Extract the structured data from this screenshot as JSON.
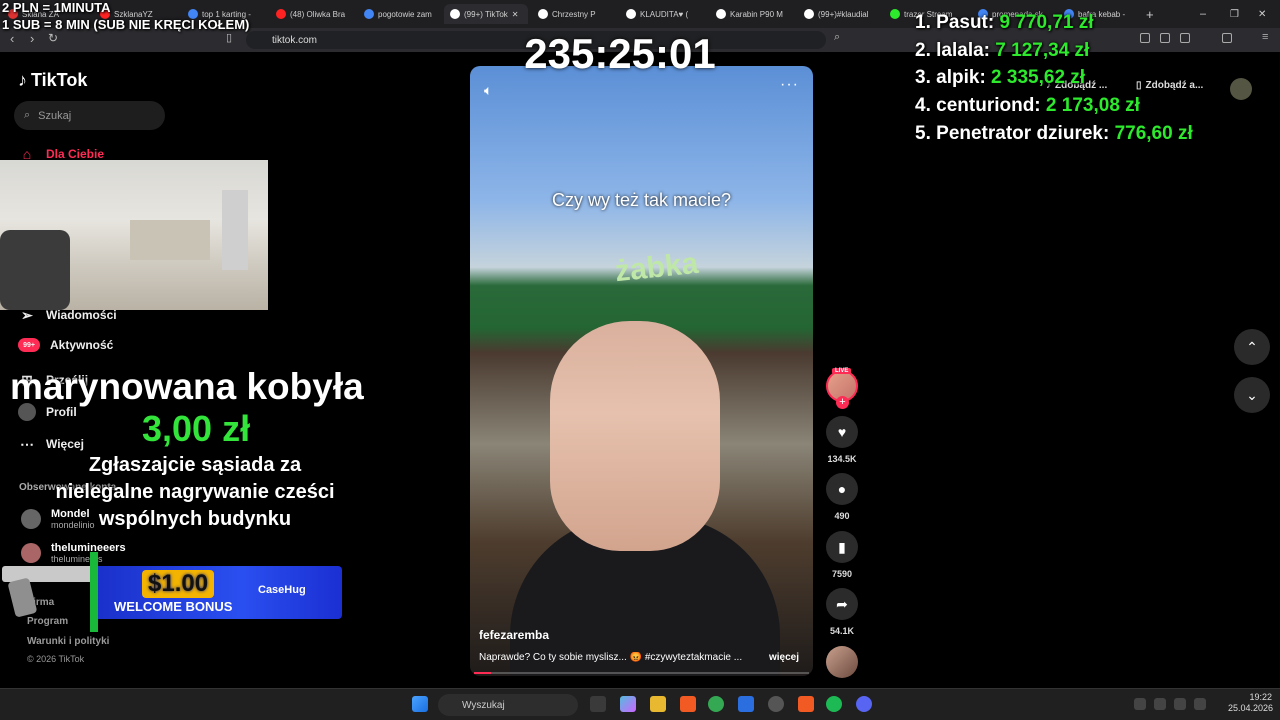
{
  "browser": {
    "tabs": [
      {
        "label": "Sklana ZA",
        "color": "#d33"
      },
      {
        "label": "SzklanaYZ",
        "color": "#f22"
      },
      {
        "label": "top 1 karting -",
        "color": "#4285f4"
      },
      {
        "label": "(48) Oliwka Bra",
        "color": "#f22"
      },
      {
        "label": "pogotowie zam",
        "color": "#4285f4"
      },
      {
        "label": "(99+) TikTok",
        "color": "#fff"
      },
      {
        "label": "Chrzestny P",
        "color": "#fff"
      },
      {
        "label": "KLAUDITA♥ (",
        "color": "#fff"
      },
      {
        "label": "Karabin P90 M",
        "color": "#fff"
      },
      {
        "label": "(99+)#klaudial",
        "color": "#fff"
      },
      {
        "label": "trazer Stream",
        "color": "#2dea2d"
      },
      {
        "label": "promenada sk",
        "color": "#4285f4"
      },
      {
        "label": "bafra kebab -",
        "color": "#4285f4"
      }
    ],
    "url": "tiktok.com"
  },
  "overlay": {
    "rule_line1": "2 PLN = 1MINUTA",
    "rule_line2": "1 SUB = 8 MIN (SUB NIE KRĘCI KOŁEM)",
    "timer": "235:25:01",
    "leaderboard": [
      {
        "rank": "1.",
        "name": "Pasut:",
        "amount": "9 770,71 zł"
      },
      {
        "rank": "2.",
        "name": "lalala:",
        "amount": "7 127,34 zł"
      },
      {
        "rank": "3.",
        "name": "alpik:",
        "amount": "2 335,62 zł"
      },
      {
        "rank": "4.",
        "name": "centuriond:",
        "amount": "2 173,08 zł"
      },
      {
        "rank": "5.",
        "name": "Penetrator dziurek:",
        "amount": "776,60 zł"
      }
    ],
    "donation": {
      "name": "marynowana kobyła",
      "amount": "3,00 zł",
      "message": "Zgłaszajcie sąsiada za nielegalne nagrywanie cześci wspólnych budynku"
    },
    "casehug": {
      "amount": "$1.00",
      "bonus": "WELCOME BONUS",
      "brand": "CaseHug"
    }
  },
  "tiktok": {
    "logo": "TikTok",
    "search_placeholder": "Szukaj",
    "nav": {
      "for_you": "Dla Ciebie",
      "messages": "Wiadomości",
      "activity": "Aktywność",
      "activity_badge": "99+",
      "upload": "Prześlij",
      "profile": "Profil",
      "more": "Więcej"
    },
    "following_header": "Obserwowane konta",
    "following": [
      {
        "name": "Mondel",
        "handle": "mondelinio"
      },
      {
        "name": "thelumineeers",
        "handle": "thelumineers"
      }
    ],
    "footer": [
      "Firma",
      "Program",
      "Warunki i polityki",
      "© 2026 TikTok"
    ],
    "promo": [
      "Zdobądź ...",
      "Zdobądź a..."
    ],
    "video": {
      "caption": "Czy wy też tak macie?",
      "store_sign": "żabka",
      "author": "fefezaremba",
      "description": "Naprawde? Co ty sobie myslisz... 😡 #czywyteztakmacie ...",
      "more": "więcej",
      "live": "LIVE",
      "likes": "134.5K",
      "comments": "490",
      "saves": "7590",
      "shares": "54.1K"
    }
  },
  "taskbar": {
    "search": "Wyszukaj",
    "time": "19:22",
    "date": "25.04.2026"
  }
}
